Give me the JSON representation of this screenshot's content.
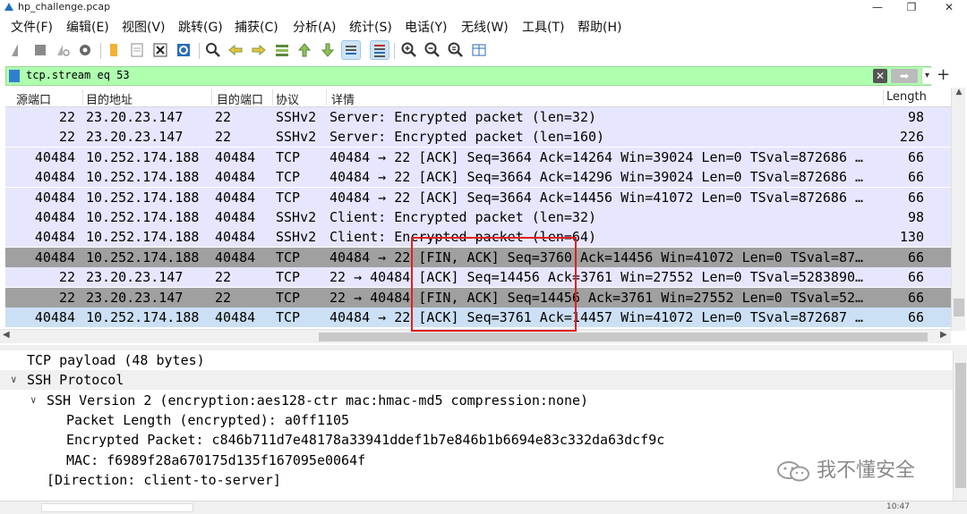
{
  "window": {
    "title": "hp_challenge.pcap",
    "buttons": {
      "minimize": "—",
      "restore": "❐",
      "close": "✕"
    }
  },
  "menu": [
    "文件(F)",
    "编辑(E)",
    "视图(V)",
    "跳转(G)",
    "捕获(C)",
    "分析(A)",
    "统计(S)",
    "电话(Y)",
    "无线(W)",
    "工具(T)",
    "帮助(H)"
  ],
  "toolbar": {
    "icons": [
      "shark-fin-start-icon",
      "stop-icon",
      "restart-icon",
      "options-gear-icon",
      "open-folder-icon",
      "save-file-icon",
      "close-file-icon",
      "reload-icon",
      "find-icon",
      "go-back-icon",
      "go-forward-icon",
      "go-to-packet-icon",
      "first-packet-icon",
      "last-packet-icon",
      "autoscroll-icon",
      "colorize-icon",
      "zoom-in-icon",
      "zoom-out-icon",
      "zoom-normal-icon",
      "resize-columns-icon"
    ]
  },
  "filter": {
    "value": "tcp.stream eq 53",
    "clear": "✕",
    "apply": "➡",
    "dropdown": "▾",
    "add": "+"
  },
  "packet_list": {
    "columns": [
      "源端口",
      "目的地址",
      "目的端口",
      "协议",
      "详情",
      "Length"
    ],
    "rows": [
      {
        "src_port": "22",
        "dst": "23.20.23.147",
        "dst_port": "22",
        "proto": "SSHv2",
        "info": "Server: Encrypted packet (len=32)",
        "length": "98",
        "style": "ssh"
      },
      {
        "src_port": "22",
        "dst": "23.20.23.147",
        "dst_port": "22",
        "proto": "SSHv2",
        "info": "Server: Encrypted packet (len=160)",
        "length": "226",
        "style": "ssh"
      },
      {
        "src_port": "40484",
        "dst": "10.252.174.188",
        "dst_port": "40484",
        "proto": "TCP",
        "info": "40484 → 22 [ACK] Seq=3664 Ack=14264 Win=39024 Len=0 TSval=872686 …",
        "length": "66",
        "style": "ssh"
      },
      {
        "src_port": "40484",
        "dst": "10.252.174.188",
        "dst_port": "40484",
        "proto": "TCP",
        "info": "40484 → 22 [ACK] Seq=3664 Ack=14296 Win=39024 Len=0 TSval=872686 …",
        "length": "66",
        "style": "ssh"
      },
      {
        "src_port": "40484",
        "dst": "10.252.174.188",
        "dst_port": "40484",
        "proto": "TCP",
        "info": "40484 → 22 [ACK] Seq=3664 Ack=14456 Win=41072 Len=0 TSval=872686 …",
        "length": "66",
        "style": "ssh"
      },
      {
        "src_port": "40484",
        "dst": "10.252.174.188",
        "dst_port": "40484",
        "proto": "SSHv2",
        "info": "Client: Encrypted packet (len=32)",
        "length": "98",
        "style": "ssh"
      },
      {
        "src_port": "40484",
        "dst": "10.252.174.188",
        "dst_port": "40484",
        "proto": "SSHv2",
        "info": "Client: Encrypted packet (len=64)",
        "length": "130",
        "style": "ssh"
      },
      {
        "src_port": "40484",
        "dst": "10.252.174.188",
        "dst_port": "40484",
        "proto": "TCP",
        "info": "40484 → 22 [FIN, ACK] Seq=3760 Ack=14456 Win=41072 Len=0 TSval=87…",
        "length": "66",
        "style": "fin"
      },
      {
        "src_port": "22",
        "dst": "23.20.23.147",
        "dst_port": "22",
        "proto": "TCP",
        "info": "22 → 40484 [ACK] Seq=14456 Ack=3761 Win=27552 Len=0 TSval=5283890…",
        "length": "66",
        "style": "ssh"
      },
      {
        "src_port": "22",
        "dst": "23.20.23.147",
        "dst_port": "22",
        "proto": "TCP",
        "info": "22 → 40484 [FIN, ACK] Seq=14456 Ack=3761 Win=27552 Len=0 TSval=52…",
        "length": "66",
        "style": "fin"
      },
      {
        "src_port": "40484",
        "dst": "10.252.174.188",
        "dst_port": "40484",
        "proto": "TCP",
        "info": "40484 → 22 [ACK] Seq=3761 Ack=14457 Win=41072 Len=0 TSval=872687 …",
        "length": "66",
        "style": "selected"
      }
    ]
  },
  "details": [
    {
      "text": "TCP payload (48 bytes)",
      "indent": 1,
      "arrow": ""
    },
    {
      "text": "SSH Protocol",
      "indent": 1,
      "arrow": "∨",
      "selected": true
    },
    {
      "text": "SSH Version 2 (encryption:aes128-ctr mac:hmac-md5 compression:none)",
      "indent": 2,
      "arrow": "∨"
    },
    {
      "text": "Packet Length (encrypted): a0ff1105",
      "indent": 3,
      "arrow": ""
    },
    {
      "text": "Encrypted Packet: c846b711d7e48178a33941ddef1b7e846b1b6694e83c332da63dcf9c",
      "indent": 3,
      "arrow": ""
    },
    {
      "text": "MAC: f6989f28a670175d135f167095e0064f",
      "indent": 3,
      "arrow": ""
    },
    {
      "text": "[Direction: client-to-server]",
      "indent": 2,
      "arrow": ""
    }
  ],
  "status": {
    "right": "10:47"
  },
  "watermark": {
    "text": "我不懂安全"
  },
  "colors": {
    "ssh_row": "#e7e6ff",
    "fin_row": "#a0a0a0",
    "selected_row": "#cce0f5",
    "filter_bg": "#afffaf",
    "highlight_box": "#e02020"
  }
}
